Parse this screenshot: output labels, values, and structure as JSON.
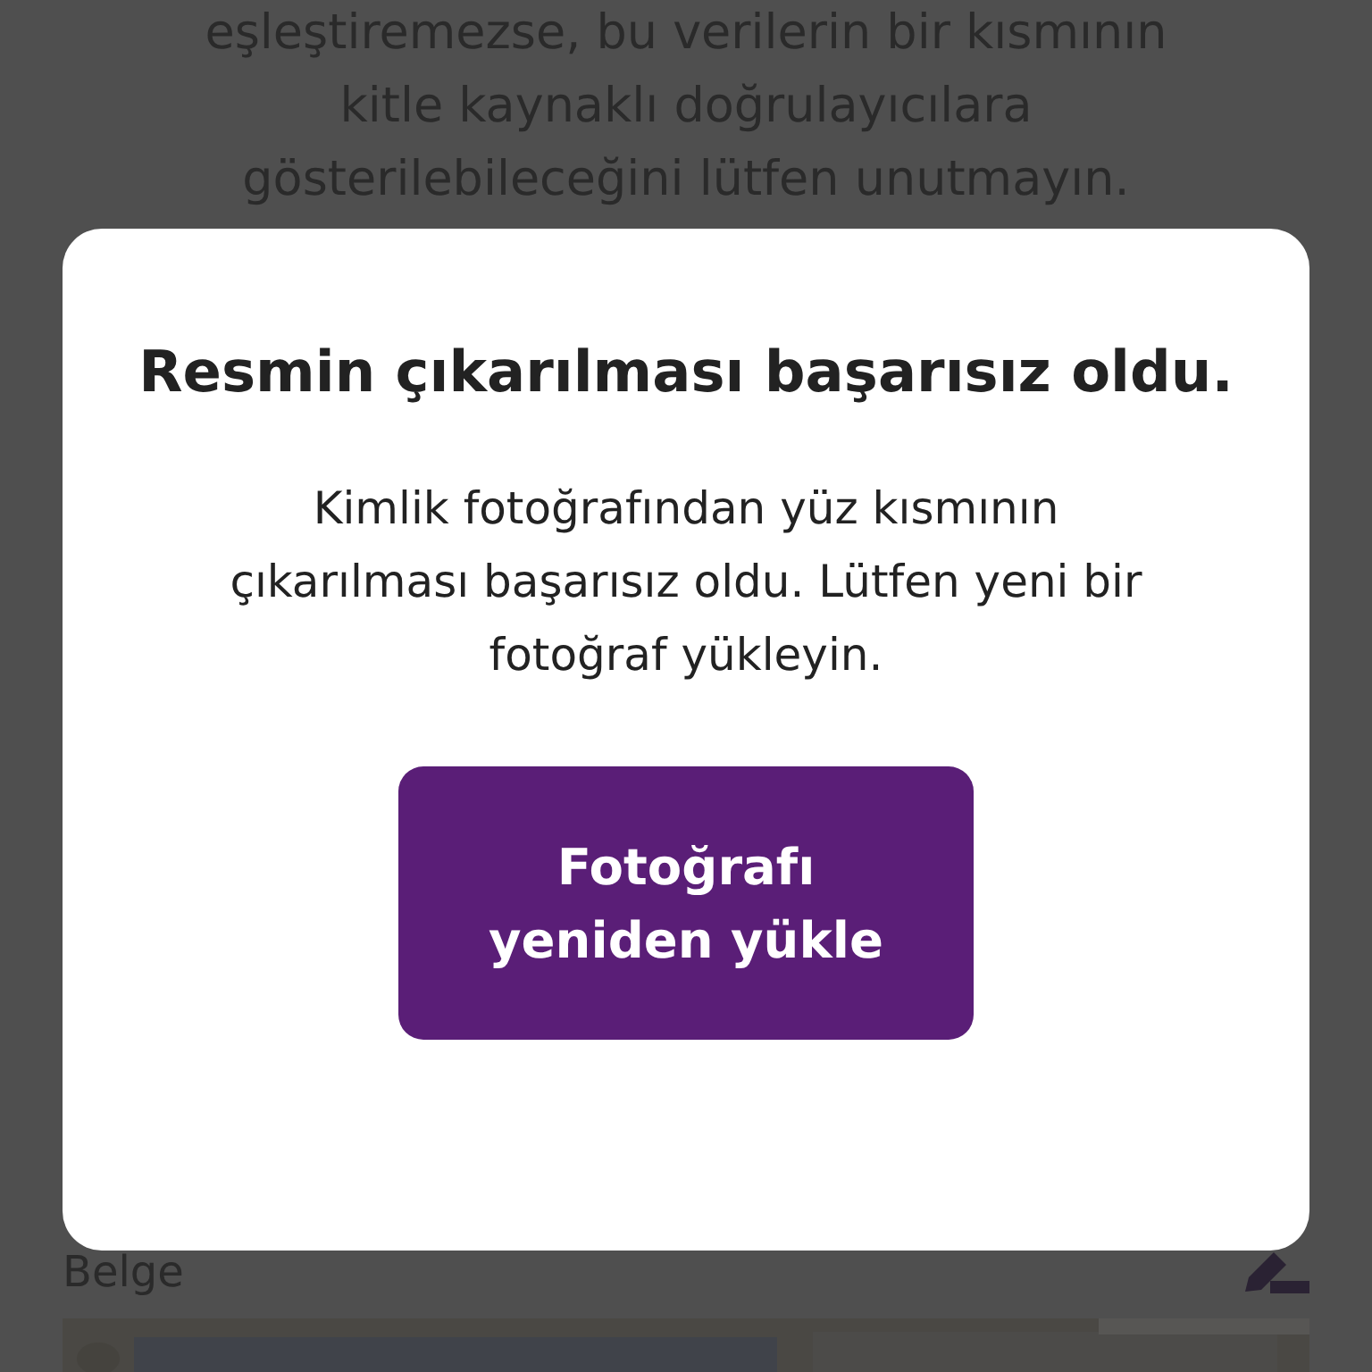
{
  "background": {
    "notice_lines": [
      "eşleştiremezse, bu verilerin bir kısmının",
      "kitle kaynaklı doğrulayıcılara",
      "gösterilebileceğini lütfen unutmayın."
    ],
    "document_label": "Belge"
  },
  "dialog": {
    "title": "Resmin çıkarılması başarısız oldu.",
    "message": "Kimlik fotoğrafından yüz kısmının çıkarılması başarısız oldu. Lütfen yeni bir fotoğraf yükleyin.",
    "button": "Fotoğrafı yeniden yükle"
  }
}
